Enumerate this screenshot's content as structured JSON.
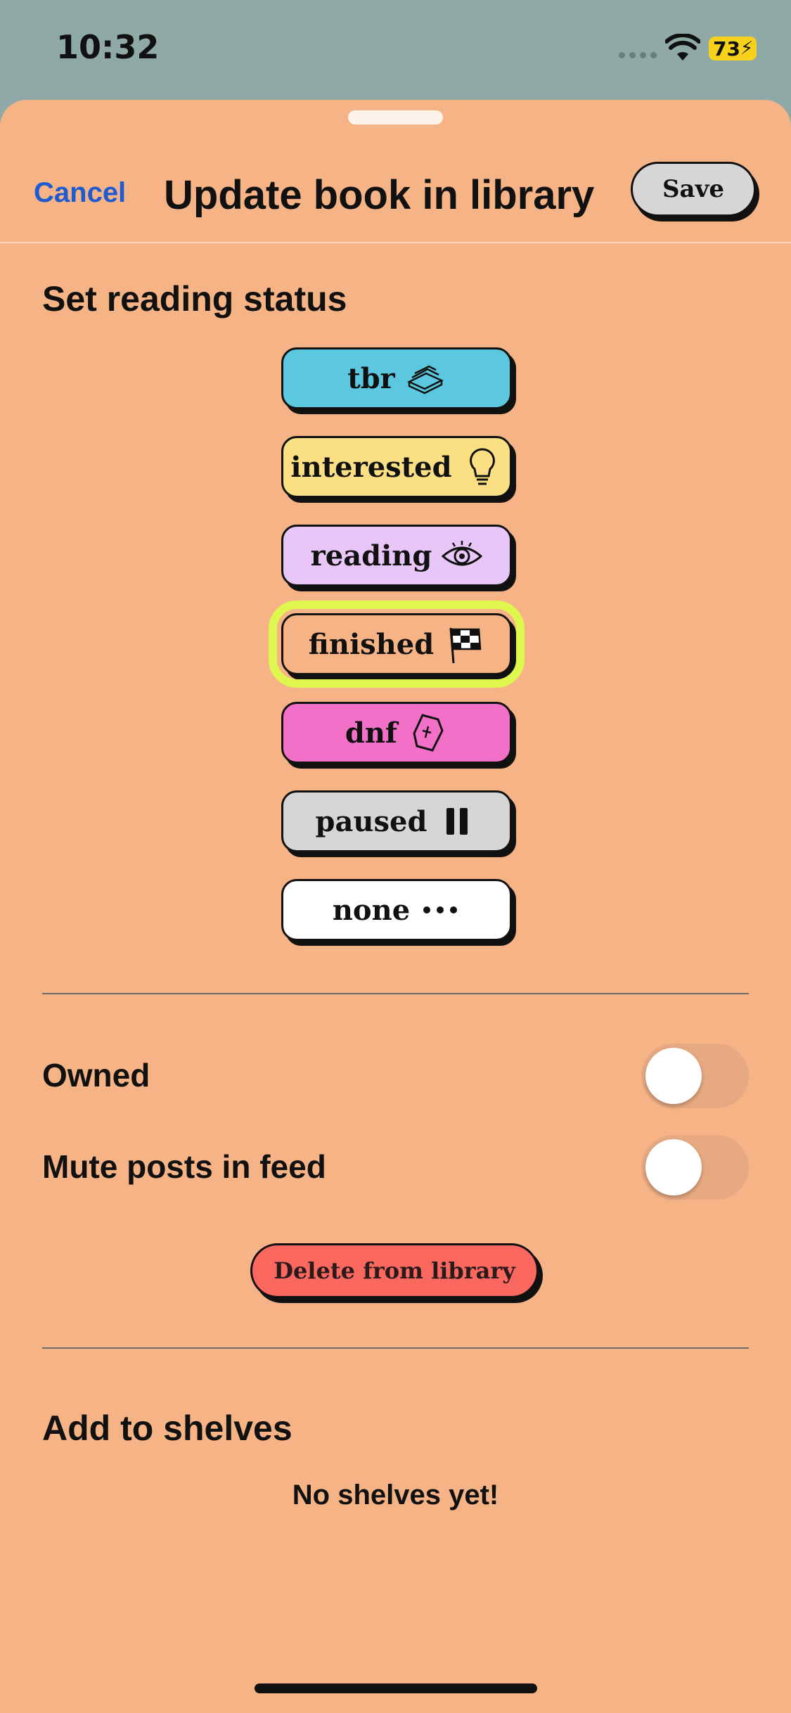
{
  "status_bar": {
    "time": "10:32",
    "battery": "73",
    "icons": [
      "cellular-signal-icon",
      "wifi-icon",
      "battery-charging-icon"
    ]
  },
  "header": {
    "cancel_label": "Cancel",
    "title": "Update book in library",
    "save_label": "Save"
  },
  "reading_status": {
    "section_title": "Set reading status",
    "options": [
      {
        "label": "tbr",
        "icon": "book-stack-icon",
        "color": "#5bc8df"
      },
      {
        "label": "interested",
        "icon": "lightbulb-icon",
        "color": "#fbe083"
      },
      {
        "label": "reading",
        "icon": "eye-icon",
        "color": "#e8c6f7"
      },
      {
        "label": "finished",
        "icon": "checkered-flag-icon",
        "color": "#f5b386",
        "selected": true
      },
      {
        "label": "dnf",
        "icon": "coffin-icon",
        "color": "#f270c8"
      },
      {
        "label": "paused",
        "icon": "pause-icon",
        "color": "#d6d6d6"
      },
      {
        "label": "none",
        "icon": "ellipsis-icon",
        "color": "#ffffff"
      }
    ],
    "selected_highlight": "#dff64e"
  },
  "settings": {
    "owned_label": "Owned",
    "owned_on": false,
    "mute_label": "Mute posts in feed",
    "mute_on": false
  },
  "delete_label": "Delete from library",
  "shelves": {
    "section_title": "Add to shelves",
    "empty_text": "No shelves yet!"
  },
  "colors": {
    "sheet_background": "#f5b386",
    "status_bar_background": "#8fa9a6",
    "cancel_link": "#1f5bd0",
    "delete_button": "#fa6860",
    "save_button": "#d6d6d6"
  }
}
